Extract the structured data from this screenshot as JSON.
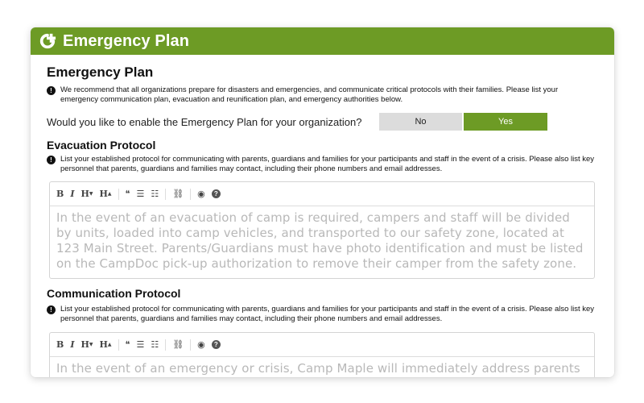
{
  "header": {
    "title": "Emergency Plan",
    "icon": "plus-circle-icon",
    "color": "#6d9b25"
  },
  "main": {
    "title": "Emergency Plan",
    "intro": "We recommend that all organizations prepare for disasters and emergencies, and communicate critical protocols with their families. Please list your emergency communication plan, evacuation and reunification plan, and emergency authorities below.",
    "question": "Would you like to enable the Emergency Plan for your organization?",
    "toggle": {
      "no_label": "No",
      "yes_label": "Yes",
      "selected": "Yes"
    }
  },
  "evacuation": {
    "title": "Evacuation Protocol",
    "note": "List your established protocol for communicating with parents, guardians and families for your participants and staff in the event of a crisis. Please also list key personnel that parents, guardians and families may contact, including their phone numbers and email addresses.",
    "placeholder": "In the event of an evacuation of camp is required, campers and staff will be divided by units, loaded into camp vehicles, and transported to our safety zone, located at 123 Main Street. Parents/Guardians must have photo identification and must be listed on the CampDoc pick-up authorization to remove their camper from the safety zone."
  },
  "communication": {
    "title": "Communication Protocol",
    "note": "List your established protocol for communicating with parents, guardians and families for your participants and staff in the event of a crisis. Please also list key personnel that parents, guardians and families may contact, including their phone numbers and email addresses.",
    "placeholder": "In the event of an emergency or crisis, Camp Maple will immediately address parents through"
  },
  "toolbar": {
    "bold": "B",
    "italic": "I",
    "heading_smaller": "H",
    "heading_bigger": "H",
    "quote": "❝",
    "ul": "☰",
    "ol": "☷",
    "link": "🔗",
    "preview": "👁",
    "help": "?"
  }
}
